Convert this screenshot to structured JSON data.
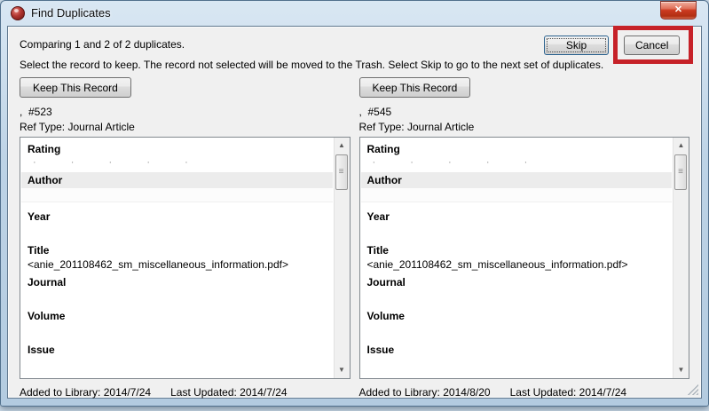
{
  "window": {
    "title": "Find Duplicates"
  },
  "icons": {
    "close": "✕",
    "scroll_up": "▲",
    "scroll_down": "▼",
    "thumb_grip": "≡",
    "rating_dots": "·  ·  ·  ·  ·"
  },
  "colors": {
    "annotation_red": "#c62128",
    "titlebar_blue": "#bdd3e6",
    "dialog_bg": "#f0f0f0",
    "close_button_red": "#cc3a20"
  },
  "header": {
    "comparing_text": "Comparing 1 and 2 of 2 duplicates.",
    "instruction_text": "Select the record to keep. The record not selected will be moved to the Trash. Select Skip to go to the next set of duplicates.",
    "skip_label": "Skip",
    "cancel_label": "Cancel"
  },
  "records": [
    {
      "keep_button_label": "Keep This Record",
      "record_id": ",  #523",
      "ref_type": "Ref Type: Journal Article",
      "fields": {
        "rating_label": "Rating",
        "author_label": "Author",
        "year_label": "Year",
        "title_label": "Title",
        "title_value": "<anie_201108462_sm_miscellaneous_information.pdf>",
        "journal_label": "Journal",
        "volume_label": "Volume",
        "issue_label": "Issue"
      },
      "added_to_library": "Added to Library: 2014/7/24",
      "last_updated": "Last Updated: 2014/7/24"
    },
    {
      "keep_button_label": "Keep This Record",
      "record_id": ",  #545",
      "ref_type": "Ref Type: Journal Article",
      "fields": {
        "rating_label": "Rating",
        "author_label": "Author",
        "year_label": "Year",
        "title_label": "Title",
        "title_value": "<anie_201108462_sm_miscellaneous_information.pdf>",
        "journal_label": "Journal",
        "volume_label": "Volume",
        "issue_label": "Issue"
      },
      "added_to_library": "Added to Library: 2014/8/20",
      "last_updated": "Last Updated: 2014/7/24"
    }
  ]
}
